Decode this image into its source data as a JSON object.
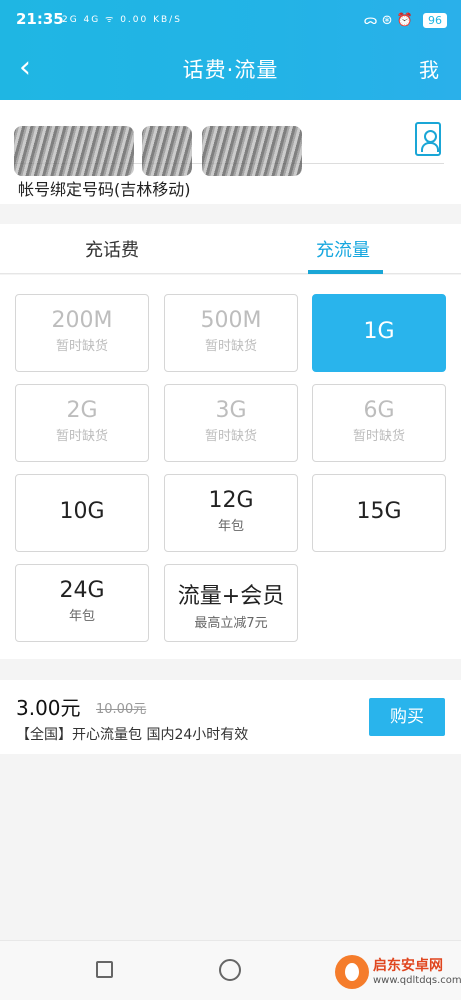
{
  "status_bar": {
    "time": "21:35",
    "left_icons_text": "2G 4G ᯤ 0.00 KB/S",
    "right_icons_text": "ᯅ ⊛ ⏰",
    "battery": "96"
  },
  "header": {
    "back_symbol": "‹",
    "title": "话费·流量",
    "me_label": "我"
  },
  "account": {
    "phone_value": "",
    "bind_label": "帐号绑定号码(吉林移动)"
  },
  "tabs": [
    {
      "label": "充话费",
      "active": false
    },
    {
      "label": "充流量",
      "active": true
    }
  ],
  "packages": [
    {
      "main": "200M",
      "sub": "暂时缺货",
      "state": "disabled"
    },
    {
      "main": "500M",
      "sub": "暂时缺货",
      "state": "disabled"
    },
    {
      "main": "1G",
      "sub": "",
      "state": "selected"
    },
    {
      "main": "2G",
      "sub": "暂时缺货",
      "state": "disabled"
    },
    {
      "main": "3G",
      "sub": "暂时缺货",
      "state": "disabled"
    },
    {
      "main": "6G",
      "sub": "暂时缺货",
      "state": "disabled"
    },
    {
      "main": "10G",
      "sub": "",
      "state": "normal"
    },
    {
      "main": "12G",
      "sub": "年包",
      "state": "normal"
    },
    {
      "main": "15G",
      "sub": "",
      "state": "normal"
    },
    {
      "main": "24G",
      "sub": "年包",
      "state": "normal"
    },
    {
      "main": "流量+会员",
      "sub": "最高立减7元",
      "state": "normal"
    }
  ],
  "purchase": {
    "price": "3.00元",
    "original_price": "10.00元",
    "description": "【全国】开心流量包 国内24小时有效",
    "buy_label": "购买"
  },
  "watermark": {
    "name": "启东安卓网",
    "url": "www.qdltdqs.com"
  },
  "colors": {
    "accent": "#29b4ec",
    "header_bg": "#1fb6e3",
    "disabled_text": "#bdbdbd"
  }
}
